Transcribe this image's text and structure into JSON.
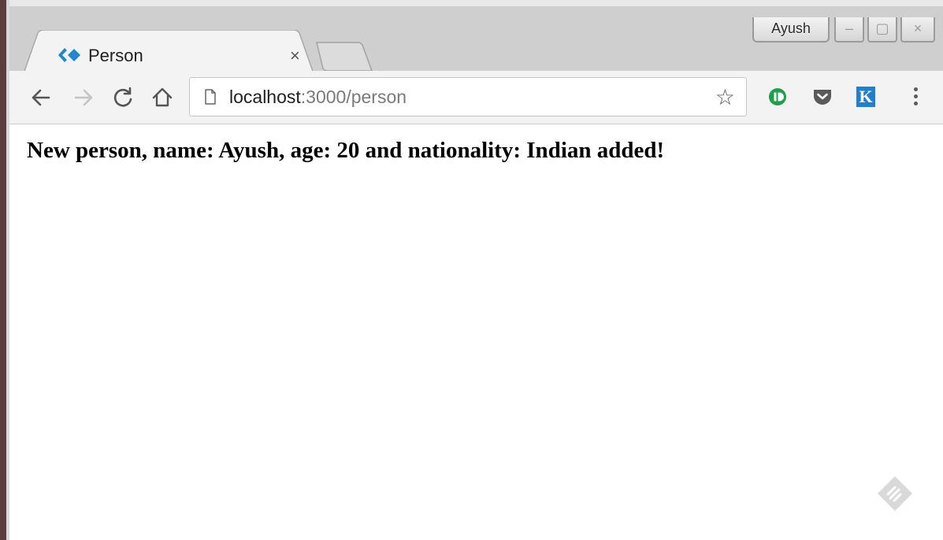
{
  "tab": {
    "title": "Person",
    "close_glyph": "×",
    "favicon": "angular-bracket-diamond-icon"
  },
  "profile": {
    "name": "Ayush"
  },
  "window_controls": {
    "minimize": "–",
    "maximize": "▢",
    "close": "×"
  },
  "address_bar": {
    "host": "localhost",
    "rest": ":3000/person"
  },
  "extensions": {
    "k_label": "K"
  },
  "page": {
    "message": "New person, name: Ayush, age: 20 and nationality: Indian added!"
  },
  "colors": {
    "favicon_blue": "#1e88d2",
    "ext_io_green": "#1ca04a",
    "ext_k_blue": "#1f7fd0",
    "pocket_gray": "#5a5a5a"
  }
}
